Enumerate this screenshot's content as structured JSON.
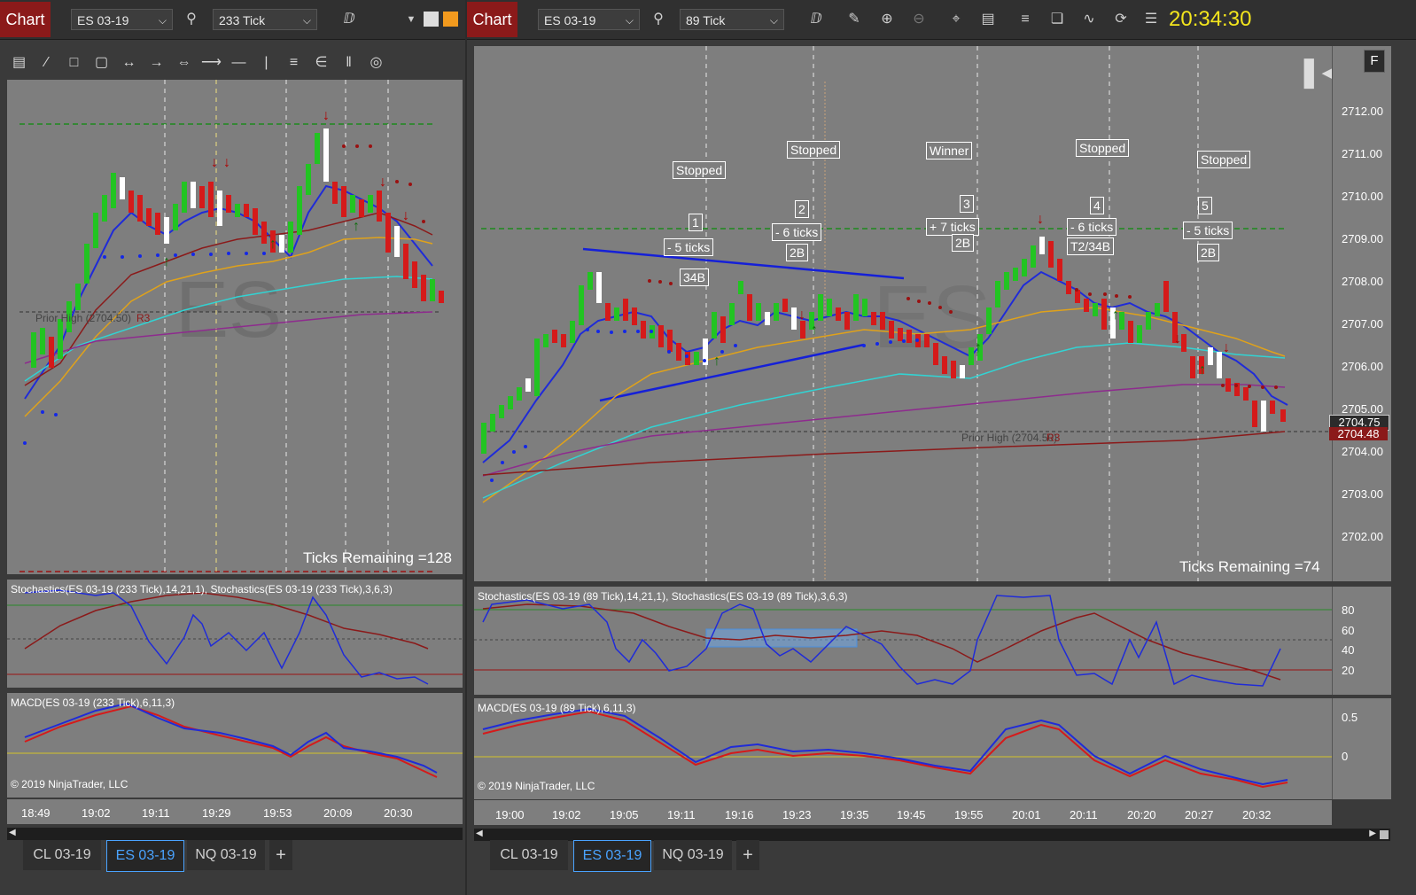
{
  "left": {
    "chart_button": "Chart",
    "instrument": "ES 03-19",
    "interval": "233 Tick",
    "ticks_remaining": "Ticks Remaining =128",
    "stoch_label": "Stochastics(ES 03-19 (233 Tick),14,21,1), Stochastics(ES 03-19 (233 Tick),3,6,3)",
    "macd_label": "MACD(ES 03-19 (233 Tick),6,11,3)",
    "copyright": "© 2019 NinjaTrader, LLC",
    "time_labels": [
      "18:49",
      "19:02",
      "19:11",
      "19:29",
      "19:53",
      "20:09",
      "20:30"
    ],
    "prior_high": "Prior High (2704.50)",
    "r3": "R3",
    "tabs": [
      "CL 03-19",
      "ES 03-19",
      "NQ 03-19",
      "+"
    ]
  },
  "right": {
    "chart_button": "Chart",
    "instrument": "ES 03-19",
    "interval": "89 Tick",
    "clock": "20:34:30",
    "f_button": "F",
    "ticks_remaining": "Ticks Remaining =74",
    "stoch_label": "Stochastics(ES 03-19 (89 Tick),14,21,1), Stochastics(ES 03-19 (89 Tick),3,6,3)",
    "macd_label": "MACD(ES 03-19 (89 Tick),6,11,3)",
    "copyright": "© 2019 NinjaTrader, LLC",
    "time_labels": [
      "19:00",
      "19:02",
      "19:05",
      "19:11",
      "19:16",
      "19:23",
      "19:35",
      "19:45",
      "19:55",
      "20:01",
      "20:11",
      "20:20",
      "20:27",
      "20:32"
    ],
    "price_labels": [
      "2712.00",
      "2711.00",
      "2710.00",
      "2709.00",
      "2708.00",
      "2707.00",
      "2706.00",
      "2705.00",
      "2704.00",
      "2703.00",
      "2702.00"
    ],
    "last_price": "2704.75",
    "marker_price": "2704.48",
    "stoch_axis": [
      "80",
      "60",
      "40",
      "20"
    ],
    "macd_axis": [
      "0.5",
      "0"
    ],
    "prior_high": "Prior High (2704.50)",
    "r3": "R3",
    "trades": [
      {
        "result": "Stopped",
        "num": "1",
        "ticks": "- 5 ticks",
        "setup": "34B"
      },
      {
        "result": "Stopped",
        "num": "2",
        "ticks": "- 6 ticks",
        "setup": "2B"
      },
      {
        "result": "Winner",
        "num": "3",
        "ticks": "+ 7 ticks",
        "setup": "2B"
      },
      {
        "result": "Stopped",
        "num": "4",
        "ticks": "- 6 ticks",
        "setup": "T2/34B"
      },
      {
        "result": "Stopped",
        "num": "5",
        "ticks": "- 5 ticks",
        "setup": "2B"
      }
    ],
    "tabs": [
      "CL 03-19",
      "ES 03-19",
      "NQ 03-19",
      "+"
    ]
  },
  "chart_data": [
    {
      "type": "candlestick",
      "instrument": "ES 03-19",
      "interval": "233 Tick",
      "x": [
        "18:49",
        "19:02",
        "19:11",
        "19:29",
        "19:53",
        "20:09",
        "20:30"
      ],
      "ylim": [
        2701.5,
        2712.5
      ]
    },
    {
      "type": "candlestick",
      "instrument": "ES 03-19",
      "interval": "89 Tick",
      "x": [
        "19:00",
        "19:02",
        "19:05",
        "19:11",
        "19:16",
        "19:23",
        "19:35",
        "19:45",
        "19:55",
        "20:01",
        "20:11",
        "20:20",
        "20:27",
        "20:32"
      ],
      "ylim": [
        2701.5,
        2712.5
      ],
      "last_price": 2704.75,
      "prior_high": 2704.5,
      "trade_lines": [
        2709.2
      ],
      "stochastics_levels": [
        20,
        40,
        60,
        80
      ],
      "macd_levels": [
        0,
        0.5
      ]
    }
  ],
  "colors": {
    "up": "#22c422",
    "down": "#d51a1a",
    "ema_fast": "#1f2bd8",
    "ema_mid": "#e0a21a",
    "ema_slow": "#32d3d3",
    "ema_long": "#8e2b8e",
    "dot_blue": "#1428e6",
    "dot_red": "#9a1111",
    "clock": "#f3e51d"
  }
}
